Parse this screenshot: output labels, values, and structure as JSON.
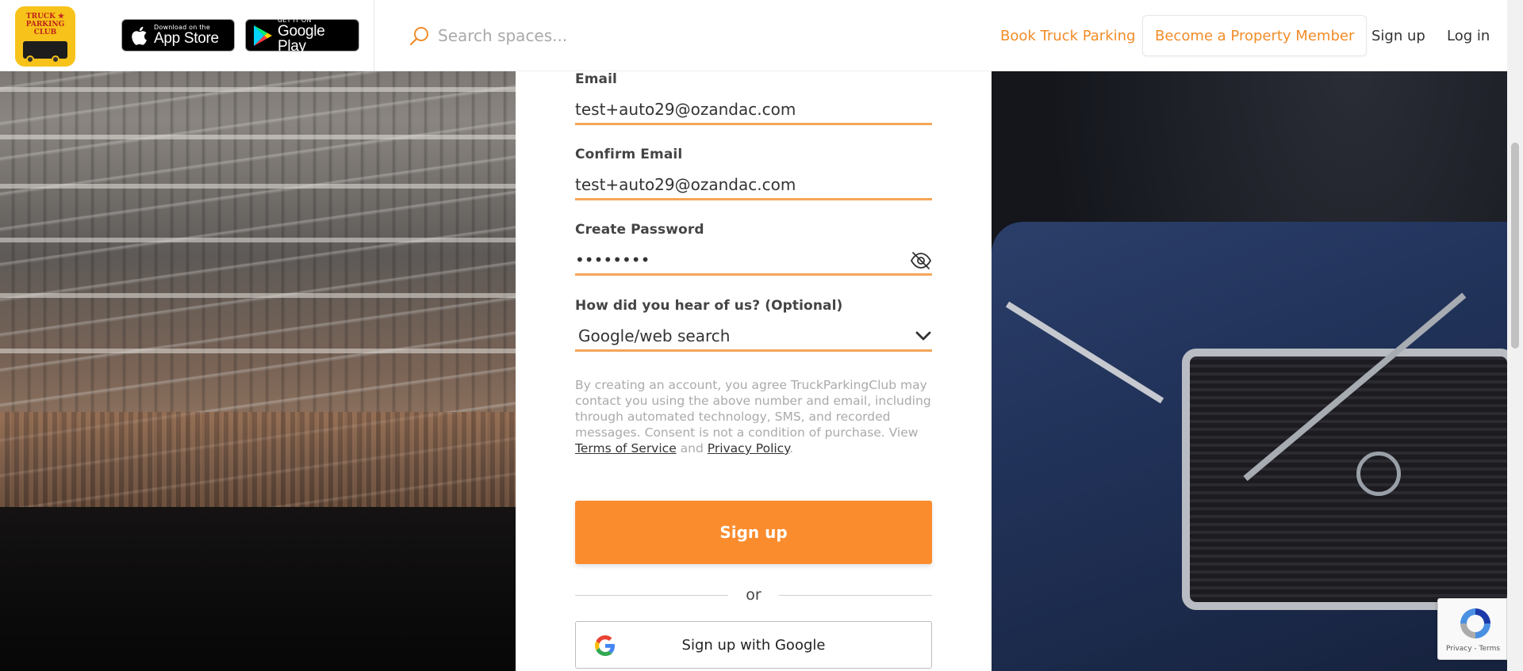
{
  "header": {
    "logo_text": "TRUCK ★ PARKING CLUB",
    "app_store": {
      "small": "Download on the",
      "big": "App Store"
    },
    "google_play": {
      "small": "GET IT ON",
      "big": "Google Play"
    },
    "search": {
      "placeholder": "Search spaces..."
    },
    "nav": {
      "book": "Book Truck Parking",
      "member": "Become a Property Member",
      "signup": "Sign up",
      "login": "Log in"
    }
  },
  "form": {
    "email": {
      "label": "Email",
      "value": "test+auto29@ozandac.com"
    },
    "confirm_email": {
      "label": "Confirm Email",
      "value": "test+auto29@ozandac.com"
    },
    "password": {
      "label": "Create Password",
      "value": "••••••••"
    },
    "referral": {
      "label": "How did you hear of us? (Optional)",
      "value": "Google/web search"
    },
    "consent": {
      "text": "By creating an account, you agree TruckParkingClub may contact you using the above number and email, including through automated technology, SMS, and recorded messages. Consent is not a condition of purchase. View ",
      "terms_link": "Terms of Service",
      "and": " and ",
      "privacy_link": "Privacy Policy",
      "end": "."
    },
    "signup_button": "Sign up",
    "or_text": "or",
    "google_button": "Sign up with Google"
  },
  "recaptcha": {
    "links": "Privacy - Terms"
  },
  "colors": {
    "accent": "#fb8c2e",
    "nav_accent": "#f28c28",
    "underline": "#f5a559"
  },
  "icons": {
    "search": "search-icon",
    "eye": "eye-slash-icon",
    "chevron": "chevron-down-icon",
    "google": "google-g-icon",
    "apple": "apple-icon",
    "play": "google-play-icon",
    "recaptcha": "recaptcha-icon"
  }
}
